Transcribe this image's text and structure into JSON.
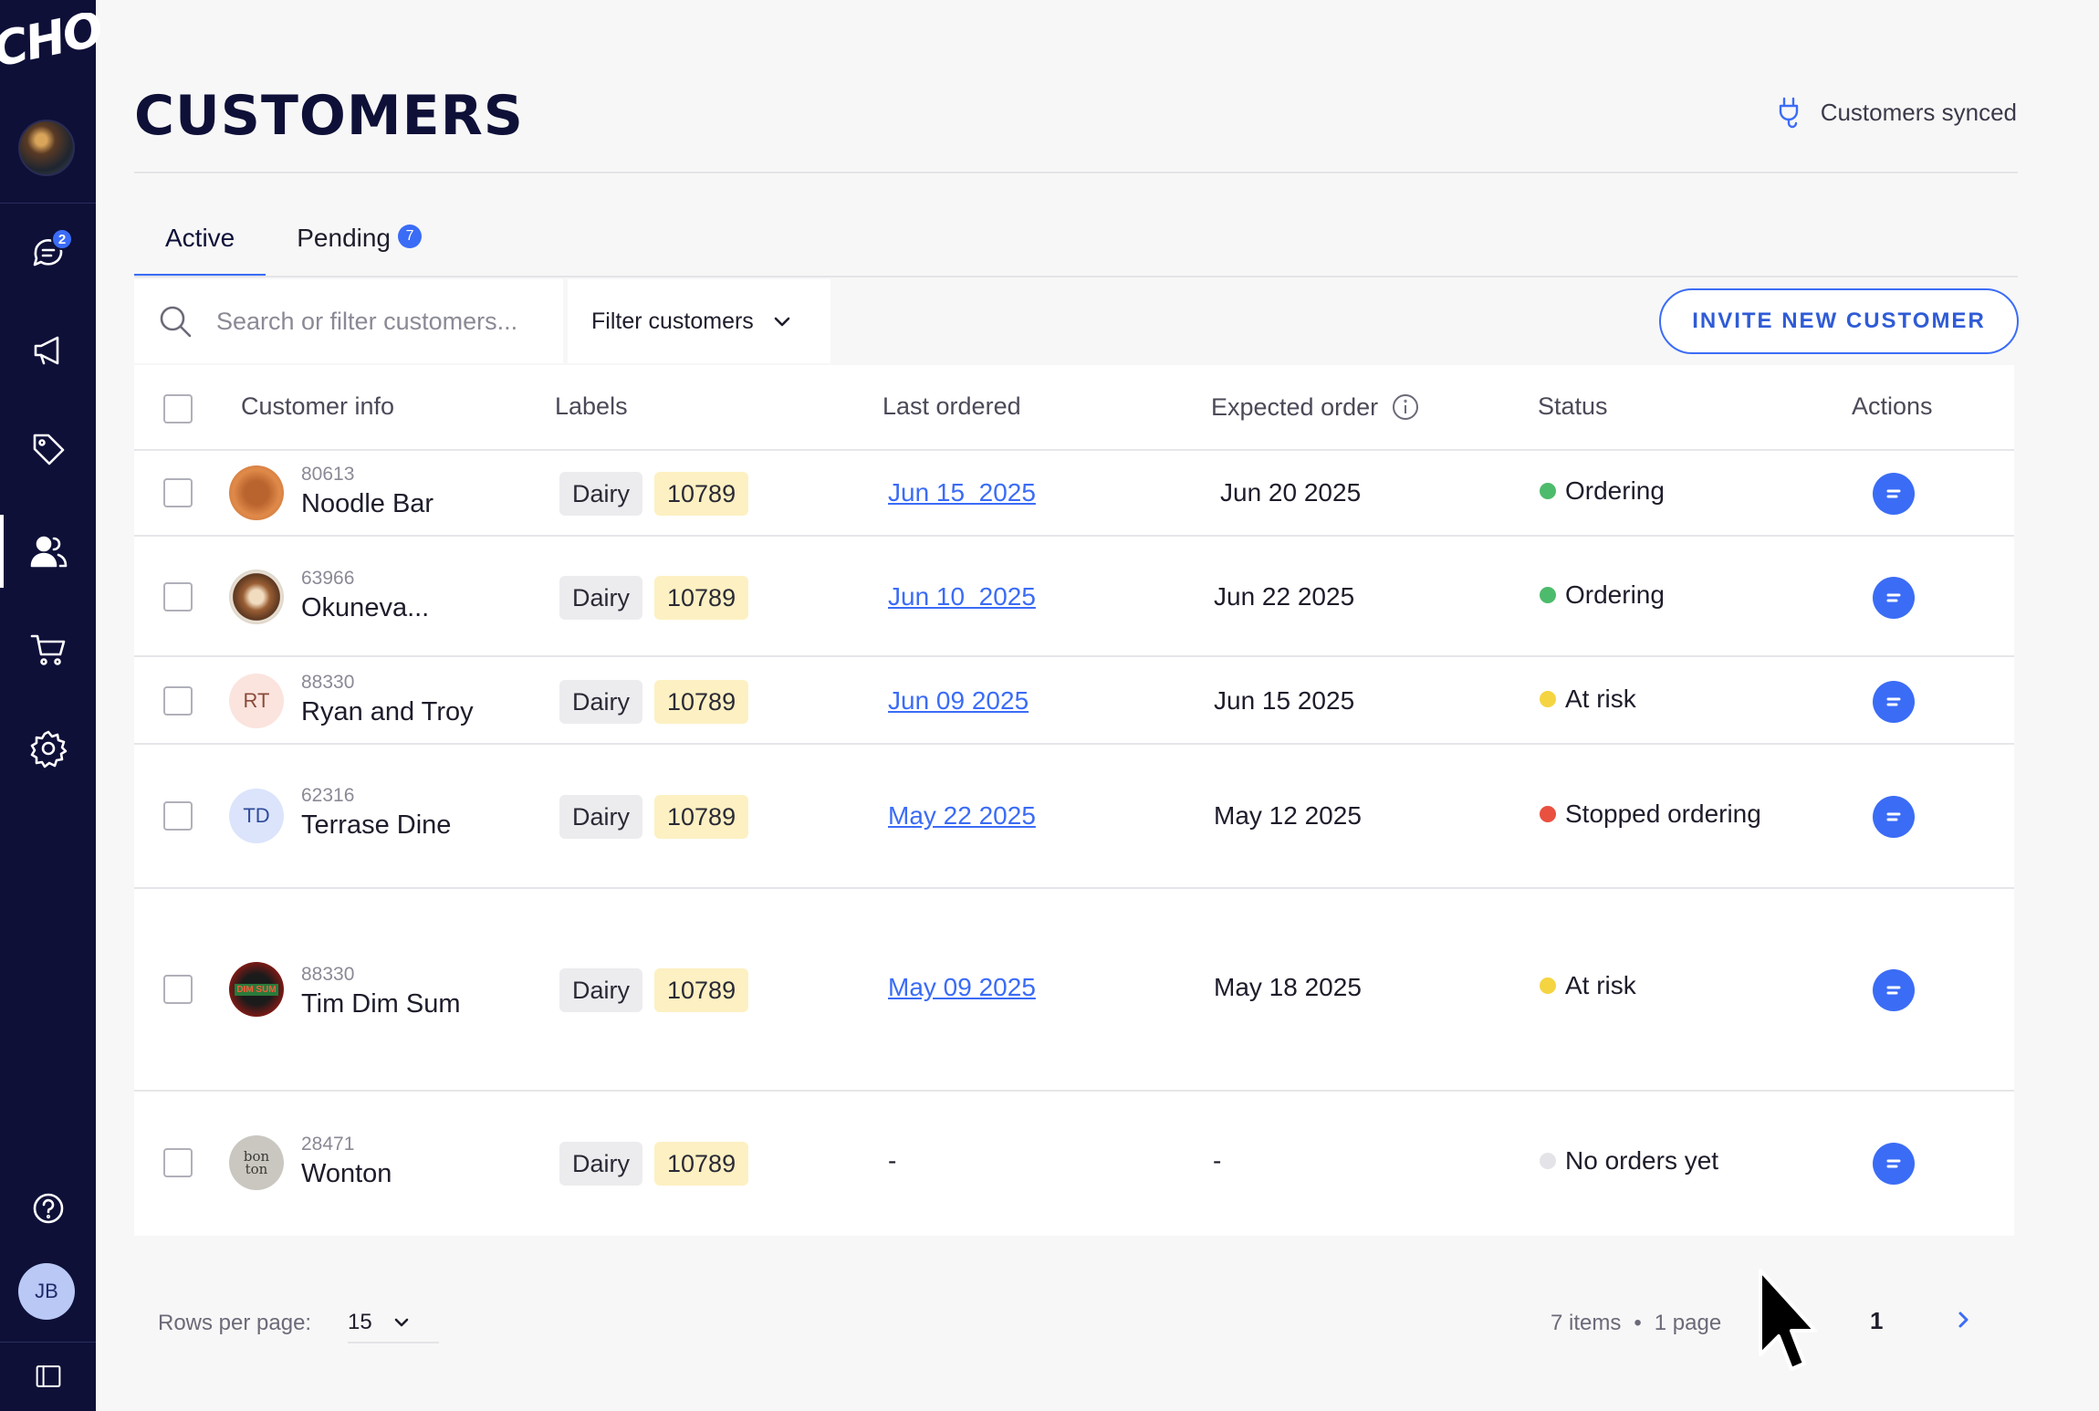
{
  "brand": {
    "logo_text": "CHOCO"
  },
  "sidebar": {
    "messages_badge": "2",
    "user_initials": "JB",
    "items": [
      {
        "name": "messages",
        "icon": "chat-bubble-icon"
      },
      {
        "name": "campaigns",
        "icon": "megaphone-icon"
      },
      {
        "name": "products",
        "icon": "tag-icon"
      },
      {
        "name": "customers",
        "icon": "users-icon",
        "active": true
      },
      {
        "name": "orders",
        "icon": "cart-icon"
      },
      {
        "name": "settings",
        "icon": "gear-icon"
      },
      {
        "name": "help",
        "icon": "help-circle-icon"
      },
      {
        "name": "collapse",
        "icon": "sidebar-collapse-icon"
      }
    ]
  },
  "header": {
    "title": "CUSTOMERS",
    "sync_status": "Customers synced"
  },
  "tabs": [
    {
      "label": "Active",
      "active": true
    },
    {
      "label": "Pending",
      "badge": "7"
    }
  ],
  "toolbar": {
    "search_placeholder": "Search or filter customers...",
    "filter_label": "Filter customers",
    "invite_label": "INVITE NEW CUSTOMER"
  },
  "table": {
    "columns": [
      "Customer info",
      "Labels",
      "Last ordered",
      "Expected order",
      "Status",
      "Actions"
    ],
    "rows": [
      {
        "id": "80613",
        "name": "Noodle Bar",
        "initials": "",
        "labels": [
          "Dairy",
          "10789"
        ],
        "last_ordered": "Jun 15  2025",
        "expected": "Jun 20 2025",
        "status": "Ordering",
        "status_color": "#4cbb6c"
      },
      {
        "id": "63966",
        "name": "Okuneva...",
        "initials": "",
        "labels": [
          "Dairy",
          "10789"
        ],
        "last_ordered": "Jun 10  2025",
        "expected": "Jun 22 2025",
        "status": "Ordering",
        "status_color": "#4cbb6c"
      },
      {
        "id": "88330",
        "name": "Ryan and Troy",
        "initials": "RT",
        "labels": [
          "Dairy",
          "10789"
        ],
        "last_ordered": "Jun 09 2025",
        "expected": "Jun 15 2025",
        "status": "At risk",
        "status_color": "#f5d442"
      },
      {
        "id": "62316",
        "name": "Terrase Dine",
        "initials": "TD",
        "labels": [
          "Dairy",
          "10789"
        ],
        "last_ordered": "May 22 2025",
        "expected": "May 12 2025",
        "status": "Stopped ordering",
        "status_color": "#e9503f"
      },
      {
        "id": "88330",
        "name": "Tim Dim Sum",
        "initials": "",
        "logo_text": "DIM SUM",
        "labels": [
          "Dairy",
          "10789"
        ],
        "last_ordered": "May 09 2025",
        "expected": "May 18 2025",
        "status": "At risk",
        "status_color": "#f5d442"
      },
      {
        "id": "28471",
        "name": "Wonton",
        "initials": "",
        "logo_text": "bon ton",
        "labels": [
          "Dairy",
          "10789"
        ],
        "last_ordered": "-",
        "expected": "-",
        "status": "No orders yet",
        "status_color": "#e4e4e8"
      }
    ]
  },
  "footer": {
    "rows_per_page_label": "Rows per page:",
    "rows_per_page_value": "15",
    "items_count": "7 items",
    "separator": "•",
    "pages_count": "1 page",
    "current_page": "1"
  },
  "colors": {
    "sidebar_bg": "#0e1038",
    "accent": "#3b6cf6",
    "label_code_bg": "#fdf0c2"
  }
}
